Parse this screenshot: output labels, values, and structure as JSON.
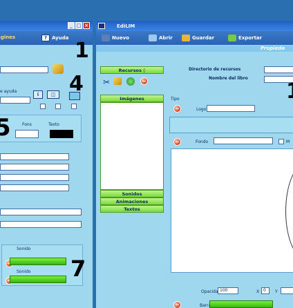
{
  "left_window": {
    "toolbar": {
      "paginas": "ágines",
      "ayuda": "Ayuda"
    },
    "help_label": "e ayuda",
    "fondo_label": "Fons",
    "texto_label": "Texto",
    "sonido1_label": "Sonido",
    "sonido2_label": "Sonido",
    "numbers": {
      "n1": "1",
      "n4": "4",
      "n5": "5",
      "n7": "7"
    }
  },
  "right_window": {
    "title": "EdiLIM",
    "toolbar": {
      "nuevo": "Nuevo",
      "abrir": "Abrir",
      "guardar": "Guardar",
      "exportar": "Exportar"
    },
    "subheader": "Propieda",
    "recursos": {
      "header": "Recursos",
      "imagenes": "Imágenes",
      "sonidos": "Sonidos",
      "animaciones": "Animaciones",
      "textos": "Textos"
    },
    "directorio_label": "Directorio de recursos",
    "nombre_label": "Nombre del libro",
    "tipo_label": "Tipo",
    "logo_label": "Logo",
    "fondo_label": "Fondo",
    "opacidad_label": "Opacidad",
    "opacidad_value": "100",
    "x_label": "X",
    "x_value": "0",
    "y_label": "Y",
    "barra_label": "Barra",
    "m_label": "M",
    "numbers": {
      "n1": "1"
    }
  }
}
